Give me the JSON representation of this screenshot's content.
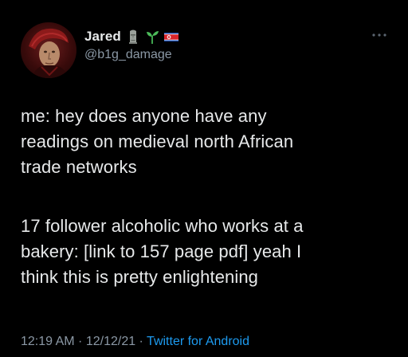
{
  "user": {
    "display_name": "Jared",
    "handle": "@b1g_damage",
    "name_emojis": [
      "moai-icon",
      "seedling-icon",
      "north-korea-flag-icon"
    ]
  },
  "tweet": {
    "paragraph1": [
      "me: hey does anyone have any",
      "readings on medieval north African",
      "trade networks"
    ],
    "paragraph2": [
      "17 follower alcoholic who works at a",
      "bakery: [link to 157 page pdf] yeah I",
      "think this is pretty enlightening"
    ]
  },
  "meta": {
    "time": "12:19 AM",
    "separator": " · ",
    "date": "12/12/21",
    "separator2": " · ",
    "source": "Twitter for Android"
  },
  "colors": {
    "background": "#000000",
    "text": "#e7e9ea",
    "secondary": "#8b98a5",
    "link": "#1d9bf0"
  },
  "icons": {
    "more": "more-horizontal-icon"
  }
}
